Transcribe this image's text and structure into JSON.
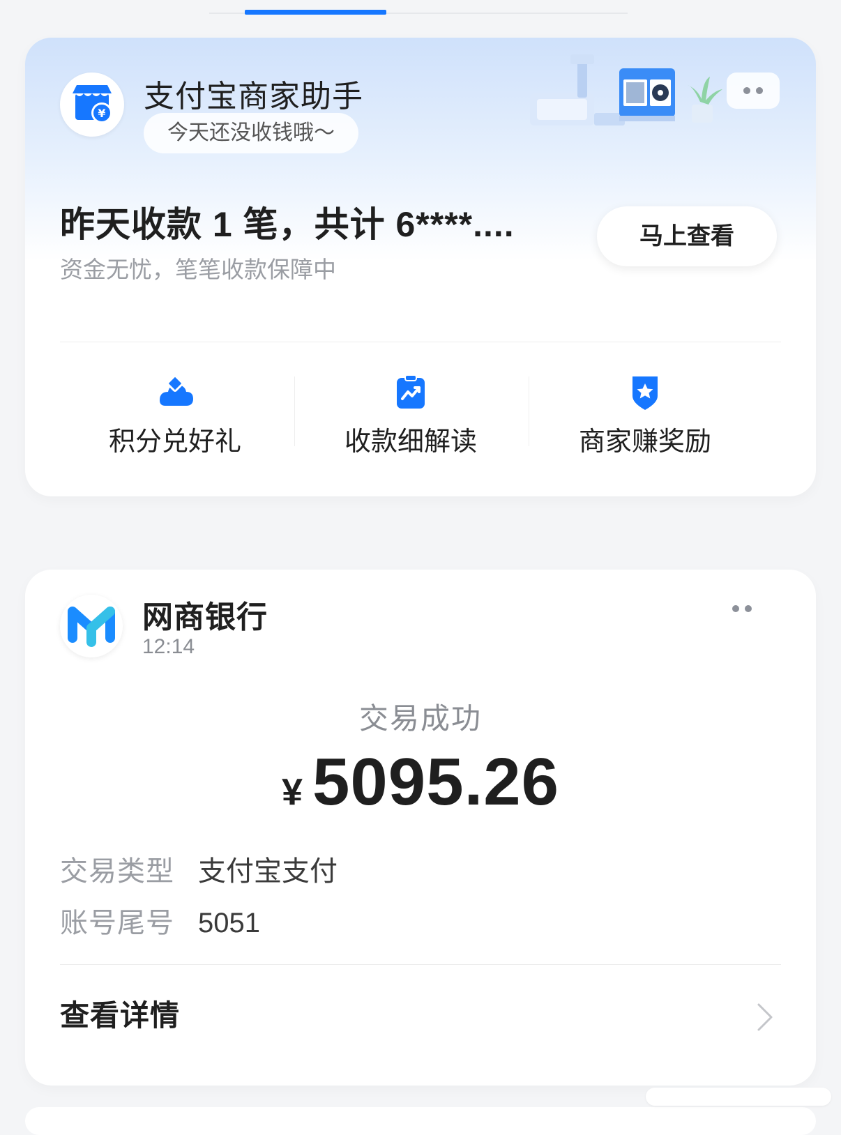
{
  "merchant_card": {
    "app_title": "支付宝商家助手",
    "status_pill": "今天还没收钱哦～",
    "summary": "昨天收款 1 笔，共计 6****....",
    "summary_sub": "资金无忧，笔笔收款保障中",
    "view_button": "马上查看",
    "quick_actions": [
      {
        "label": "积分兑好礼",
        "icon": "cloud-coin-icon"
      },
      {
        "label": "收款细解读",
        "icon": "clipboard-chart-icon"
      },
      {
        "label": "商家赚奖励",
        "icon": "star-shield-icon"
      }
    ]
  },
  "bank_card": {
    "name": "网商银行",
    "time": "12:14",
    "status": "交易成功",
    "currency": "¥",
    "amount": "5095.26",
    "rows": [
      {
        "key": "交易类型",
        "value": "支付宝支付"
      },
      {
        "key": "账号尾号",
        "value": "5051"
      }
    ],
    "detail_link": "查看详情"
  },
  "colors": {
    "accent": "#1677ff",
    "card_gradient_top": "#cfe1fb",
    "text_primary": "#1f1f1f",
    "text_secondary": "#9a9da3"
  }
}
